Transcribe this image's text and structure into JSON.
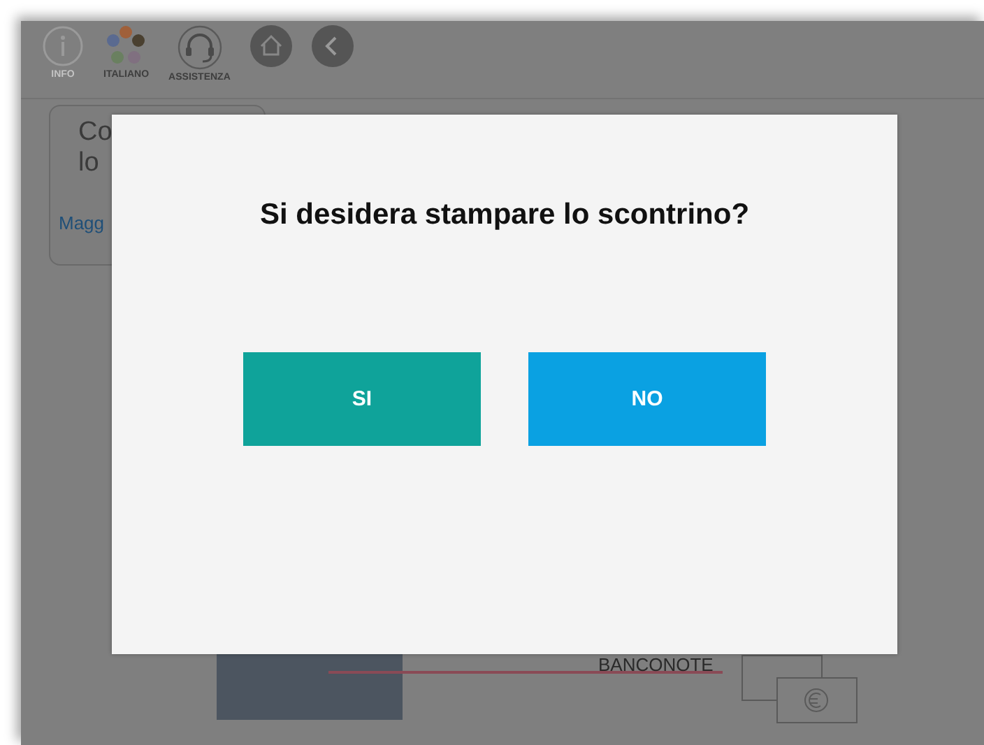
{
  "header": {
    "items": [
      {
        "kind": "info",
        "label": "INFO"
      },
      {
        "kind": "language",
        "label": "ITALIANO"
      },
      {
        "kind": "support",
        "label": "ASSISTENZA"
      },
      {
        "kind": "home"
      },
      {
        "kind": "back"
      }
    ]
  },
  "tooltip": {
    "lines": [
      "Co",
      "lo"
    ],
    "link": "Magg"
  },
  "illustration": {
    "label": "BANCONOTE"
  },
  "dialog": {
    "title": "Si desidera stampare lo scontrino?",
    "buttons": [
      {
        "kind": "yes",
        "label": "SI"
      },
      {
        "kind": "no",
        "label": "NO"
      }
    ]
  }
}
